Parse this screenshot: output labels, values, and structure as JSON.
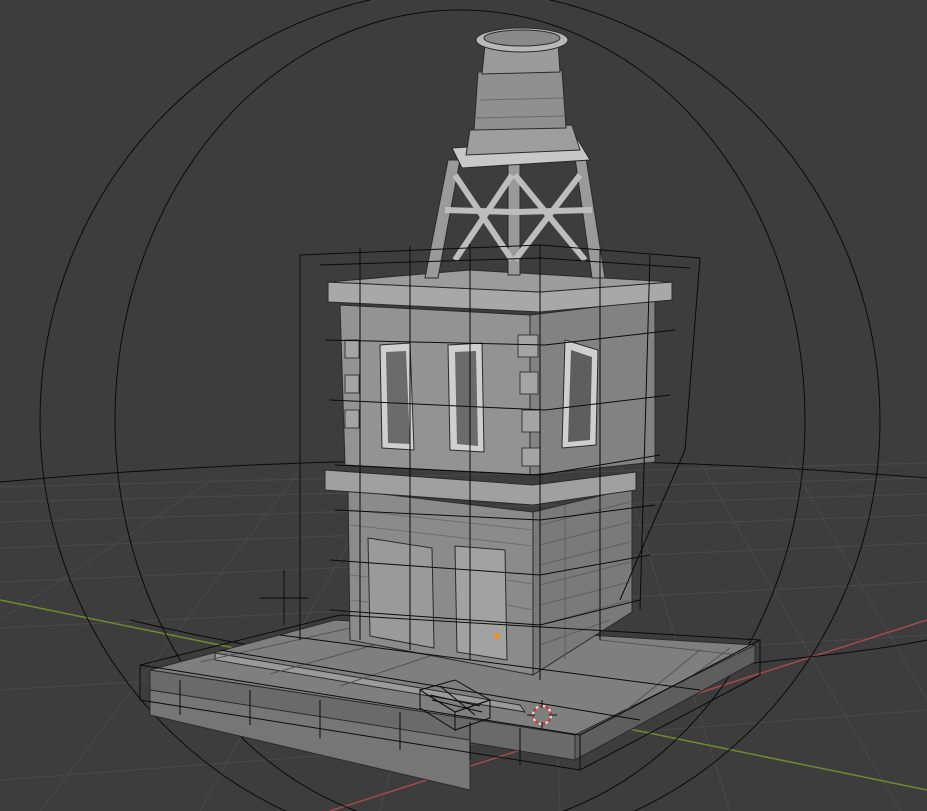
{
  "app": {
    "name": "3D viewport"
  },
  "viewport": {
    "background": "#3d3d3d",
    "grid_color": "#4a4a4a",
    "x_axis_color": "#a54a4a",
    "y_axis_color": "#6e8c2e",
    "wire_color": "#0a0a0a",
    "model_color": "#8e8e8e"
  },
  "objects": [
    {
      "name": "building",
      "kind": "mesh"
    },
    {
      "name": "water-tower",
      "kind": "mesh"
    },
    {
      "name": "street-base",
      "kind": "mesh"
    },
    {
      "name": "cage-lattice",
      "kind": "wireframe"
    },
    {
      "name": "sphere-bound",
      "kind": "wireframe"
    },
    {
      "name": "empty-cross",
      "kind": "empty"
    },
    {
      "name": "bench-crate",
      "kind": "wireframe"
    }
  ],
  "cursor": {
    "icon": "3d-cursor-icon"
  }
}
